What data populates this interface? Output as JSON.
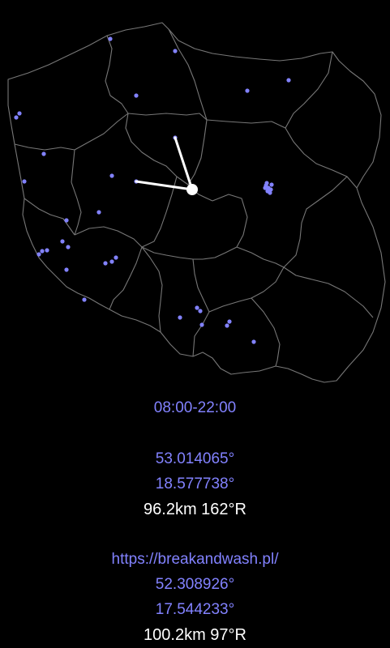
{
  "map": {
    "country": "Poland",
    "colors": {
      "background": "#000000",
      "border": "#777777",
      "point": "#8282ff",
      "pointer": "#ffffff"
    }
  },
  "info": {
    "hours": "08:00-22:00",
    "point1": {
      "lat": "53.014065°",
      "lon": "18.577738°",
      "distance": "96.2km 162°R"
    },
    "point2": {
      "url": "https://breakandwash.pl/",
      "lat": "52.308926°",
      "lon": "17.544233°",
      "distance": "100.2km 97°R"
    }
  }
}
